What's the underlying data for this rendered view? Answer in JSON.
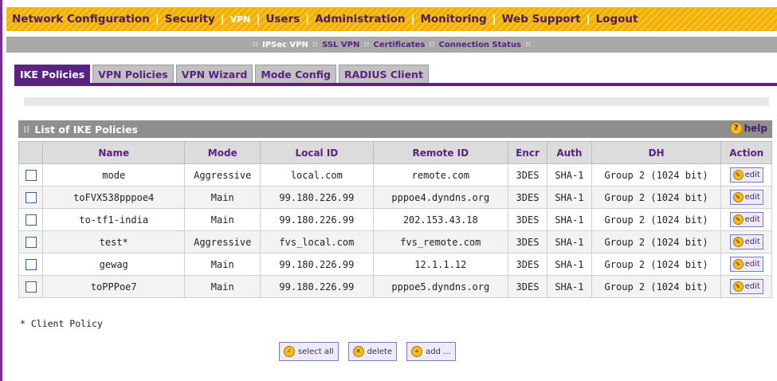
{
  "topnav": {
    "items": [
      {
        "label": "Network Configuration"
      },
      {
        "label": "Security"
      },
      {
        "label": "VPN"
      },
      {
        "label": "Users"
      },
      {
        "label": "Administration"
      },
      {
        "label": "Monitoring"
      },
      {
        "label": "Web Support"
      },
      {
        "label": "Logout"
      }
    ],
    "separator": "|"
  },
  "subnav": {
    "dots": "::",
    "items": [
      {
        "label": "IPSec VPN"
      },
      {
        "label": "SSL VPN"
      },
      {
        "label": "Certificates"
      },
      {
        "label": "Connection Status"
      }
    ]
  },
  "tabs": [
    {
      "label": "IKE Policies"
    },
    {
      "label": "VPN Policies"
    },
    {
      "label": "VPN Wizard"
    },
    {
      "label": "Mode Config"
    },
    {
      "label": "RADIUS Client"
    }
  ],
  "panel": {
    "grip": "⁞⁞",
    "title": "List of IKE Policies",
    "help_icon": "?",
    "help_label": "help"
  },
  "table": {
    "headers": [
      "",
      "Name",
      "Mode",
      "Local ID",
      "Remote ID",
      "Encr",
      "Auth",
      "DH",
      "Action"
    ],
    "edit_label": "edit",
    "rows": [
      {
        "name": "mode",
        "mode": "Aggressive",
        "local_id": "local.com",
        "remote_id": "remote.com",
        "encr": "3DES",
        "auth": "SHA-1",
        "dh": "Group 2 (1024 bit)"
      },
      {
        "name": "toFVX538pppoe4",
        "mode": "Main",
        "local_id": "99.180.226.99",
        "remote_id": "pppoe4.dyndns.org",
        "encr": "3DES",
        "auth": "SHA-1",
        "dh": "Group 2 (1024 bit)"
      },
      {
        "name": "to-tf1-india",
        "mode": "Main",
        "local_id": "99.180.226.99",
        "remote_id": "202.153.43.18",
        "encr": "3DES",
        "auth": "SHA-1",
        "dh": "Group 2 (1024 bit)"
      },
      {
        "name": "test*",
        "mode": "Aggressive",
        "local_id": "fvs_local.com",
        "remote_id": "fvs_remote.com",
        "encr": "3DES",
        "auth": "SHA-1",
        "dh": "Group 2 (1024 bit)"
      },
      {
        "name": "gewag",
        "mode": "Main",
        "local_id": "99.180.226.99",
        "remote_id": "12.1.1.12",
        "encr": "3DES",
        "auth": "SHA-1",
        "dh": "Group 2 (1024 bit)"
      },
      {
        "name": "toPPPoe7",
        "mode": "Main",
        "local_id": "99.180.226.99",
        "remote_id": "pppoe5.dyndns.org",
        "encr": "3DES",
        "auth": "SHA-1",
        "dh": "Group 2 (1024 bit)"
      }
    ]
  },
  "note": "* Client Policy",
  "actions": {
    "select_all": "select all",
    "delete": "delete",
    "add": "add ..."
  },
  "colors": {
    "nav_gold": "#f7bf1b",
    "purple": "#5a2283",
    "grey_bar": "#a9a9a9"
  }
}
